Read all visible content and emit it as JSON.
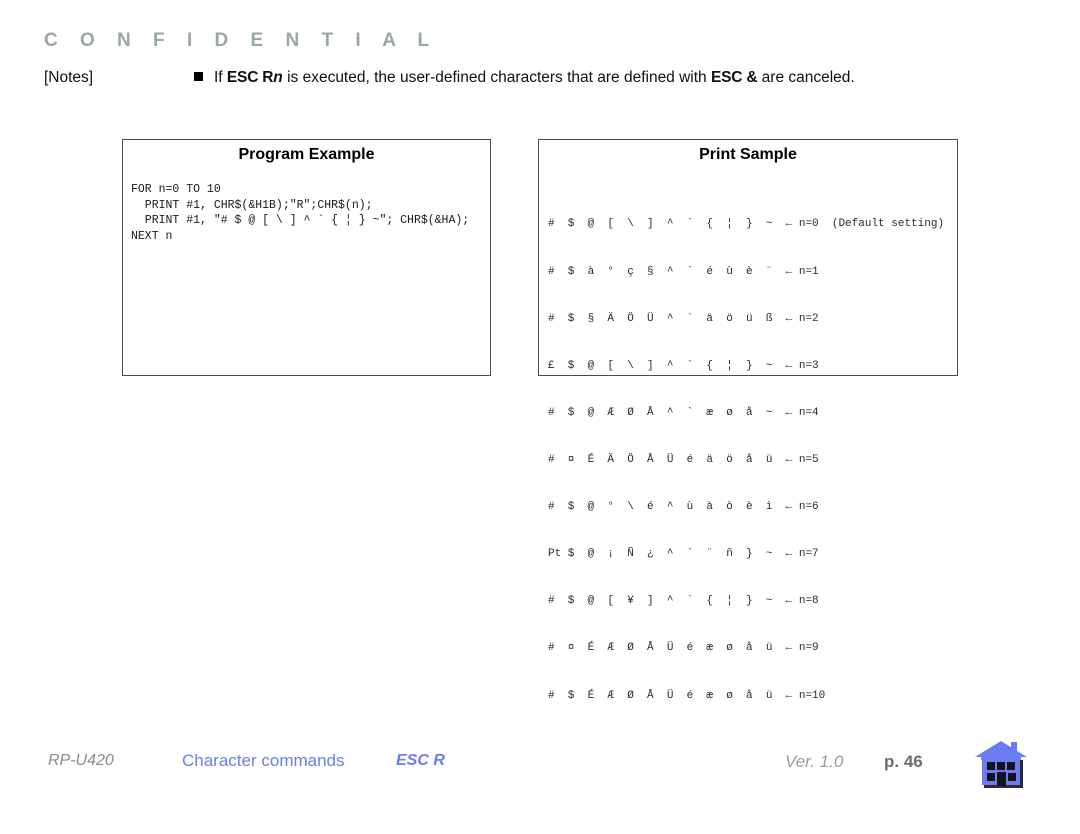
{
  "header": {
    "confidential": "C O N F I D E N T I A L"
  },
  "notes": {
    "label": "[Notes]",
    "bullet_icon": "filled-square-bullet",
    "text_part1": "If ",
    "command1": "ESC R",
    "command1_param": "n",
    "text_part2": " is executed, the user-defined characters that are defined with ",
    "command2": "ESC &",
    "text_part3": " are canceled."
  },
  "program_example": {
    "title": "Program Example",
    "code": "FOR n=0 TO 10\n  PRINT #1, CHR$(&H1B);\"R\";CHR$(n);\n  PRINT #1, \"# $ @ [ \\ ] ^ ` { ¦ } ~\"; CHR$(&HA);\nNEXT n"
  },
  "print_sample": {
    "title": "Print Sample",
    "lines": [
      "#  $  @  [  \\  ]  ^  `  {  ¦  }  ~  ← n=0  (Default setting)",
      "#  $  à  °  ç  §  ^  `  é  ù  è  ¨  ← n=1",
      "#  $  §  Ä  Ö  Ü  ^  `  ä  ö  ü  ß  ← n=2",
      "£  $  @  [  \\  ]  ^  `  {  ¦  }  ~  ← n=3",
      "#  $  @  Æ  Ø  Å  ^  `  æ  ø  å  ~  ← n=4",
      "#  ¤  É  Ä  Ö  Å  Ü  é  ä  ö  å  ü  ← n=5",
      "#  $  @  °  \\  é  ^  ù  à  ò  è  ì  ← n=6",
      "Pt $  @  ¡  Ñ  ¿  ^  `  ¨  ñ  }  ~  ← n=7",
      "#  $  @  [  ¥  ]  ^  `  {  ¦  }  ~  ← n=8",
      "#  ¤  É  Æ  Ø  Å  Ü  é  æ  ø  å  ü  ← n=9",
      "#  $  É  Æ  Ø  Å  Ü  é  æ  ø  å  ü  ← n=10"
    ]
  },
  "footer": {
    "model": "RP-U420",
    "section": "Character commands",
    "command": "ESC R",
    "version": "Ver. 1.0",
    "page": "p. 46",
    "home_icon": "home-icon"
  },
  "colors": {
    "confidential": "#9aa8a4",
    "link_blue": "#6c7cf0",
    "house_blue": "#6b7cf0",
    "house_dark": "#1b1b28",
    "footer_gray": "#8a8a8a"
  }
}
